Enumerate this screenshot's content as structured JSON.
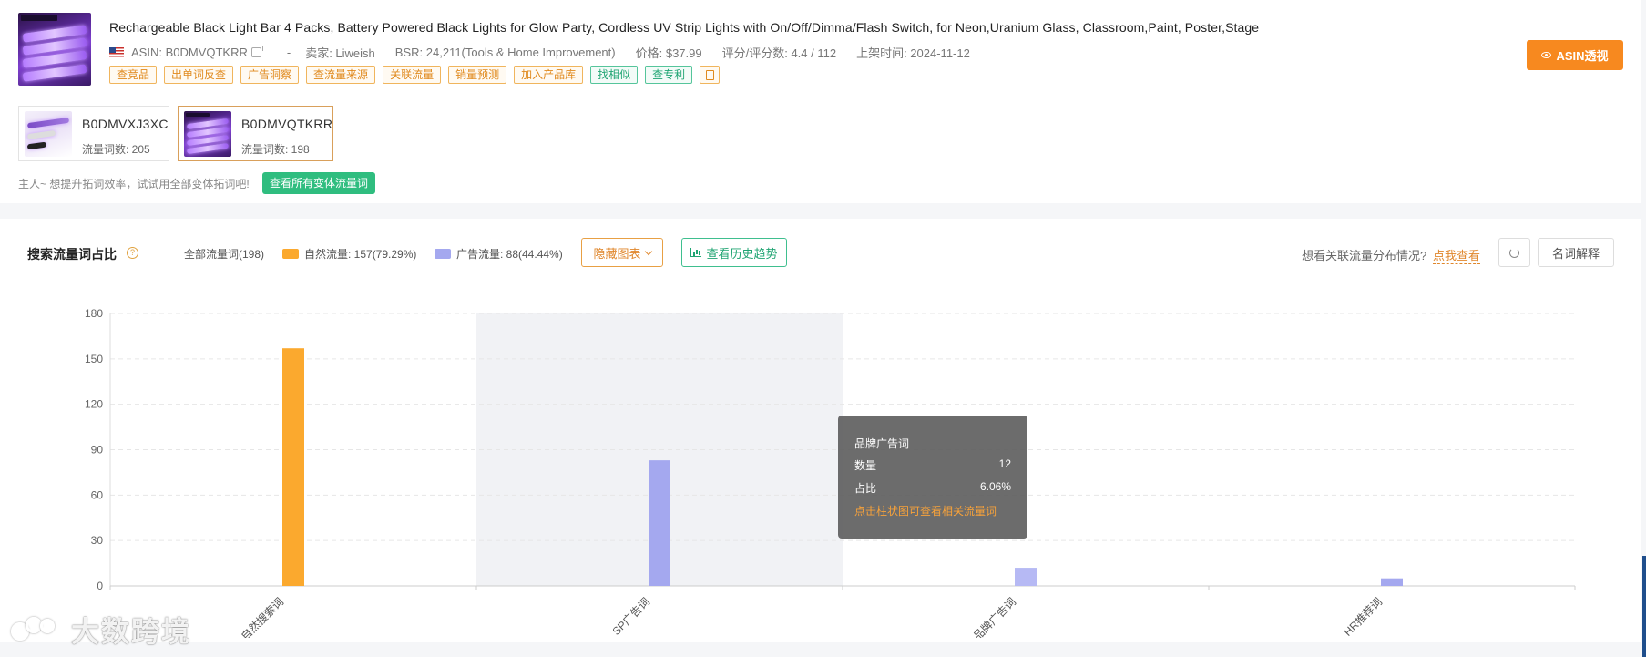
{
  "product": {
    "title": "Rechargeable Black Light Bar 4 Packs, Battery Powered Black Lights for Glow Party, Cordless UV Strip Lights with On/Off/Dimma/Flash Switch, for Neon,Uranium Glass, Classroom,Paint, Poster,Stage",
    "asin": "ASIN: B0DMVQTKRR",
    "dash": "-",
    "seller": "卖家: Liweish",
    "bsr": "BSR: 24,211(Tools & Home Improvement)",
    "price": "价格: $37.99",
    "rating": "评分/评分数: 4.4 / 112",
    "listed": "上架时间: 2024-11-12",
    "tags": [
      "查竞品",
      "出单词反查",
      "广告洞察",
      "查流量来源",
      "关联流量",
      "销量预测",
      "加入产品库"
    ],
    "green_tags": [
      "找相似",
      "查专利"
    ],
    "asin_button": "ASIN透视"
  },
  "variants": [
    {
      "asin": "B0DMVXJ3XC",
      "count": "流量词数: 205"
    },
    {
      "asin": "B0DMVQTKRR",
      "count": "流量词数: 198"
    }
  ],
  "hint": {
    "text": "主人~ 想提升拓词效率，试试用全部变体拓词吧!",
    "button": "查看所有变体流量词"
  },
  "chart_header": {
    "title": "搜索流量词占比",
    "legend_all": "全部流量词(198)",
    "legend_natural": "自然流量: 157(79.29%)",
    "legend_ad": "广告流量: 88(44.44%)",
    "hide_button": "隐藏图表",
    "history_button": "查看历史趋势",
    "related_question": "想看关联流量分布情况?",
    "related_link": "点我查看",
    "glossary_button": "名词解释"
  },
  "colors": {
    "natural": "#fba92e",
    "ad": "#a4a8ef",
    "brand": "#b6b9f4",
    "accent": "#f7891f",
    "green": "#2fbd7f"
  },
  "chart_data": {
    "type": "bar",
    "categories": [
      "自然搜索词",
      "SP广告词",
      "品牌广告词",
      "HR推荐词"
    ],
    "values": [
      157,
      83,
      12,
      5
    ],
    "ylim": [
      0,
      180
    ],
    "yticks": [
      "0",
      "30",
      "60",
      "90",
      "120",
      "150",
      "180"
    ],
    "highlighted_category": "SP广告词",
    "grid": true
  },
  "tooltip": {
    "title": "品牌广告词",
    "count_label": "数量",
    "count_value": "12",
    "ratio_label": "占比",
    "ratio_value": "6.06%",
    "link": "点击柱状图可查看相关流量词"
  },
  "watermark": "大数跨境"
}
